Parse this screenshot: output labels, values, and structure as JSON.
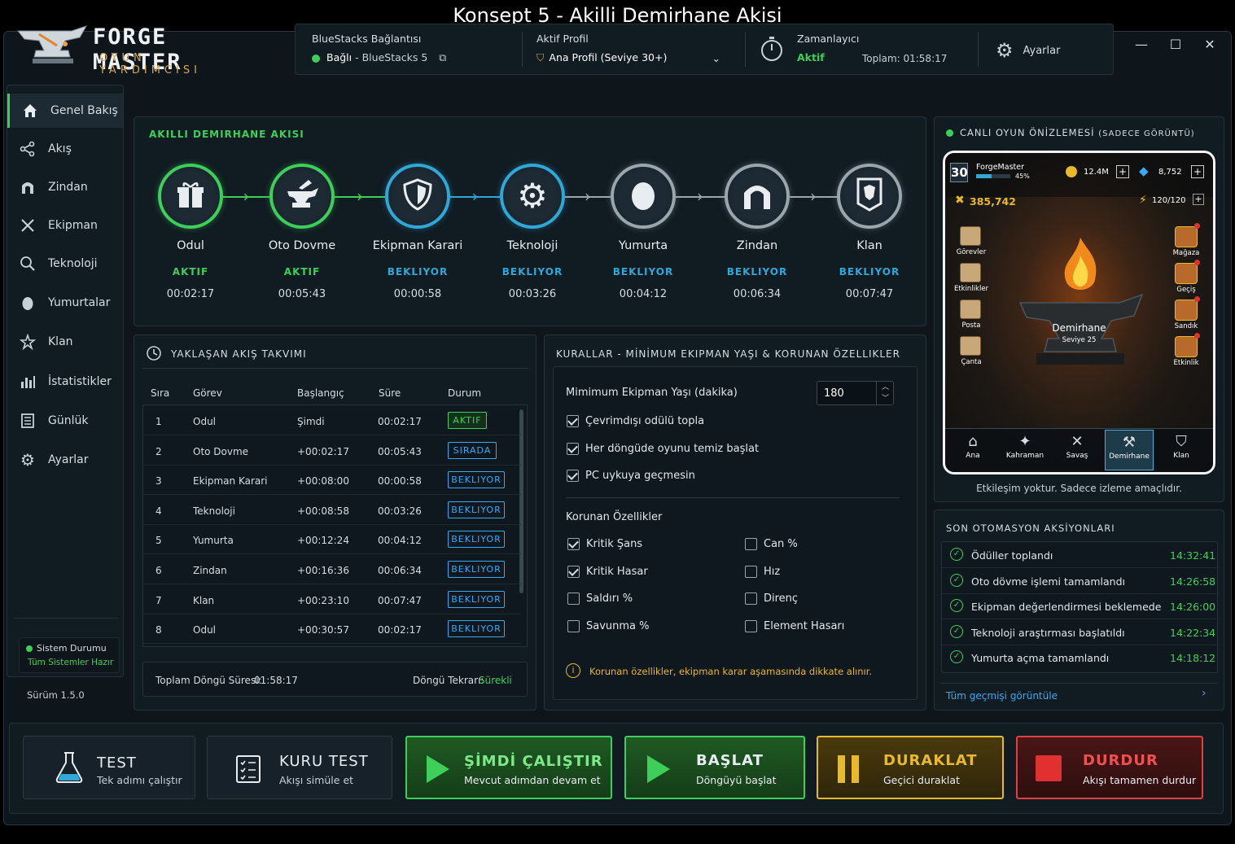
{
  "caption": "Konsept 5 - Akilli Demirhane Akisi",
  "logo": {
    "title": "FORGE MASTER",
    "subtitle": "OYUN YARDIMCISI"
  },
  "header": {
    "connection_label": "BlueStacks Bağlantısı",
    "connection_status": "Bağlı",
    "connection_target": "- BlueStacks 5",
    "profile_label": "Aktif Profil",
    "profile_value": "Ana Profil (Seviye 30+)",
    "timer_label": "Zamanlayıcı",
    "timer_status": "Aktif",
    "timer_total": "Toplam: 01:58:17",
    "settings_label": "Ayarlar"
  },
  "sidebar": {
    "items": [
      {
        "label": "Genel Bakış",
        "icon": "home-icon"
      },
      {
        "label": "Akış",
        "icon": "share-icon"
      },
      {
        "label": "Zindan",
        "icon": "gate-icon"
      },
      {
        "label": "Ekipman",
        "icon": "swords-icon"
      },
      {
        "label": "Teknoloji",
        "icon": "research-icon"
      },
      {
        "label": "Yumurtalar",
        "icon": "egg-icon"
      },
      {
        "label": "Klan",
        "icon": "clan-icon"
      },
      {
        "label": "İstatistikler",
        "icon": "stats-icon"
      },
      {
        "label": "Günlük",
        "icon": "journal-icon"
      },
      {
        "label": "Ayarlar",
        "icon": "gear-icon"
      }
    ],
    "system_status_label": "Sistem Durumu",
    "system_status_value": "Tüm Sistemler Hazır",
    "version": "Sürüm 1.5.0"
  },
  "flow": {
    "title": "AKILLI DEMIRHANE AKISI",
    "nodes": [
      {
        "label": "Odul",
        "status": "AKTIF",
        "time": "00:02:17",
        "icon": "gift-icon"
      },
      {
        "label": "Oto Dovme",
        "status": "AKTIF",
        "time": "00:05:43",
        "icon": "anvil-icon"
      },
      {
        "label": "Ekipman Karari",
        "status": "BEKLIYOR",
        "time": "00:00:58",
        "icon": "shield-icon"
      },
      {
        "label": "Teknoloji",
        "status": "BEKLIYOR",
        "time": "00:03:26",
        "icon": "gear-icon"
      },
      {
        "label": "Yumurta",
        "status": "BEKLIYOR",
        "time": "00:04:12",
        "icon": "egg-icon"
      },
      {
        "label": "Zindan",
        "status": "BEKLIYOR",
        "time": "00:06:34",
        "icon": "gate-icon"
      },
      {
        "label": "Klan",
        "status": "BEKLIYOR",
        "time": "00:07:47",
        "icon": "banner-icon"
      }
    ]
  },
  "schedule": {
    "title": "YAKLAŞAN AKIŞ TAKVIMI",
    "columns": [
      "Sıra",
      "Görev",
      "Başlangıç",
      "Süre",
      "Durum"
    ],
    "rows": [
      {
        "n": "1",
        "task": "Odul",
        "start": "Şimdi",
        "dur": "00:02:17",
        "status": "AKTIF"
      },
      {
        "n": "2",
        "task": "Oto Dovme",
        "start": "+00:02:17",
        "dur": "00:05:43",
        "status": "SIRADA"
      },
      {
        "n": "3",
        "task": "Ekipman Karari",
        "start": "+00:08:00",
        "dur": "00:00:58",
        "status": "BEKLIYOR"
      },
      {
        "n": "4",
        "task": "Teknoloji",
        "start": "+00:08:58",
        "dur": "00:03:26",
        "status": "BEKLIYOR"
      },
      {
        "n": "5",
        "task": "Yumurta",
        "start": "+00:12:24",
        "dur": "00:04:12",
        "status": "BEKLIYOR"
      },
      {
        "n": "6",
        "task": "Zindan",
        "start": "+00:16:36",
        "dur": "00:06:34",
        "status": "BEKLIYOR"
      },
      {
        "n": "7",
        "task": "Klan",
        "start": "+00:23:10",
        "dur": "00:07:47",
        "status": "BEKLIYOR"
      },
      {
        "n": "8",
        "task": "Odul",
        "start": "+00:30:57",
        "dur": "00:02:17",
        "status": "BEKLIYOR"
      }
    ],
    "total_label": "Toplam Döngü Süresi:",
    "total_value": "01:58:17",
    "repeat_label": "Döngü Tekrarı:",
    "repeat_value": "Sürekli"
  },
  "rules": {
    "title": "KURALLAR - MİNİMUM EKIPMAN YAŞI & KORUNAN ÖZELLIKLER",
    "min_age_label": "Mimimum Ekipman Yaşı (dakika)",
    "min_age_value": "180",
    "options": [
      {
        "label": "Çevrimdışı odülü topla",
        "checked": true
      },
      {
        "label": "Her döngüde oyunu temiz başlat",
        "checked": true
      },
      {
        "label": "PC uykuya geçmesin",
        "checked": true
      }
    ],
    "protected_title": "Korunan Özellikler",
    "protected": [
      {
        "label": "Kritik Şans",
        "checked": true
      },
      {
        "label": "Can %",
        "checked": false
      },
      {
        "label": "Kritik Hasar",
        "checked": true
      },
      {
        "label": "Hız",
        "checked": false
      },
      {
        "label": "Saldırı %",
        "checked": false
      },
      {
        "label": "Direnç",
        "checked": false
      },
      {
        "label": "Savunma %",
        "checked": false
      },
      {
        "label": "Element Hasarı",
        "checked": false
      }
    ],
    "note": "Korunan özellikler, ekipman karar aşamasında dikkate alınır."
  },
  "preview": {
    "title": "CANLI OYUN ÖNİZLEMESİ",
    "title_sub": "(SADECE GÖRÜNTÜ)",
    "level": "30",
    "player": "ForgeMaster",
    "xp_pct": "45%",
    "gold": "12.4M",
    "gems": "8,752",
    "power": "385,742",
    "energy": "120/120",
    "left_menu": [
      "Görevler",
      "Etkinlikler",
      "Posta",
      "Çanta"
    ],
    "right_menu": [
      "Mağaza",
      "Geçiş",
      "Sandık",
      "Etkinlik"
    ],
    "forge_name": "Demirhane",
    "forge_level": "Seviye 25",
    "bottom_nav": [
      "Ana",
      "Kahraman",
      "Savaş",
      "Demirhane",
      "Klan"
    ],
    "footer": "Etkileşim yoktur. Sadece izleme amaçlıdır."
  },
  "actions": {
    "title": "SON OTOMASYON AKSİYONLARI",
    "items": [
      {
        "text": "Ödüller toplandı",
        "time": "14:32:41"
      },
      {
        "text": "Oto dövme işlemi tamamlandı",
        "time": "14:26:58"
      },
      {
        "text": "Ekipman değerlendirmesi beklemede",
        "time": "14:26:00"
      },
      {
        "text": "Teknoloji araştırması başlatıldı",
        "time": "14:22:34"
      },
      {
        "text": "Yumurta açma tamamlandı",
        "time": "14:18:12"
      }
    ],
    "view_all": "Tüm geçmişi görüntüle"
  },
  "buttons": {
    "test_title": "TEST",
    "test_sub": "Tek adımı çalıştır",
    "dry_title": "KURU TEST",
    "dry_sub": "Akışı simüle et",
    "run_title": "ŞİMDİ ÇALIŞTIR",
    "run_sub": "Mevcut adımdan devam et",
    "start_title": "BAŞLAT",
    "start_sub": "Döngüyü başlat",
    "pause_title": "DURAKLAT",
    "pause_sub": "Geçici duraklat",
    "stop_title": "DURDUR",
    "stop_sub": "Akışı tamamen durdur"
  },
  "colors": {
    "active": "#3ecf5a",
    "waiting": "#2fa8d8",
    "idle": "#9aa6ae",
    "accent": "#d9a64a",
    "pause": "#e8b92a",
    "stop": "#e04040"
  }
}
